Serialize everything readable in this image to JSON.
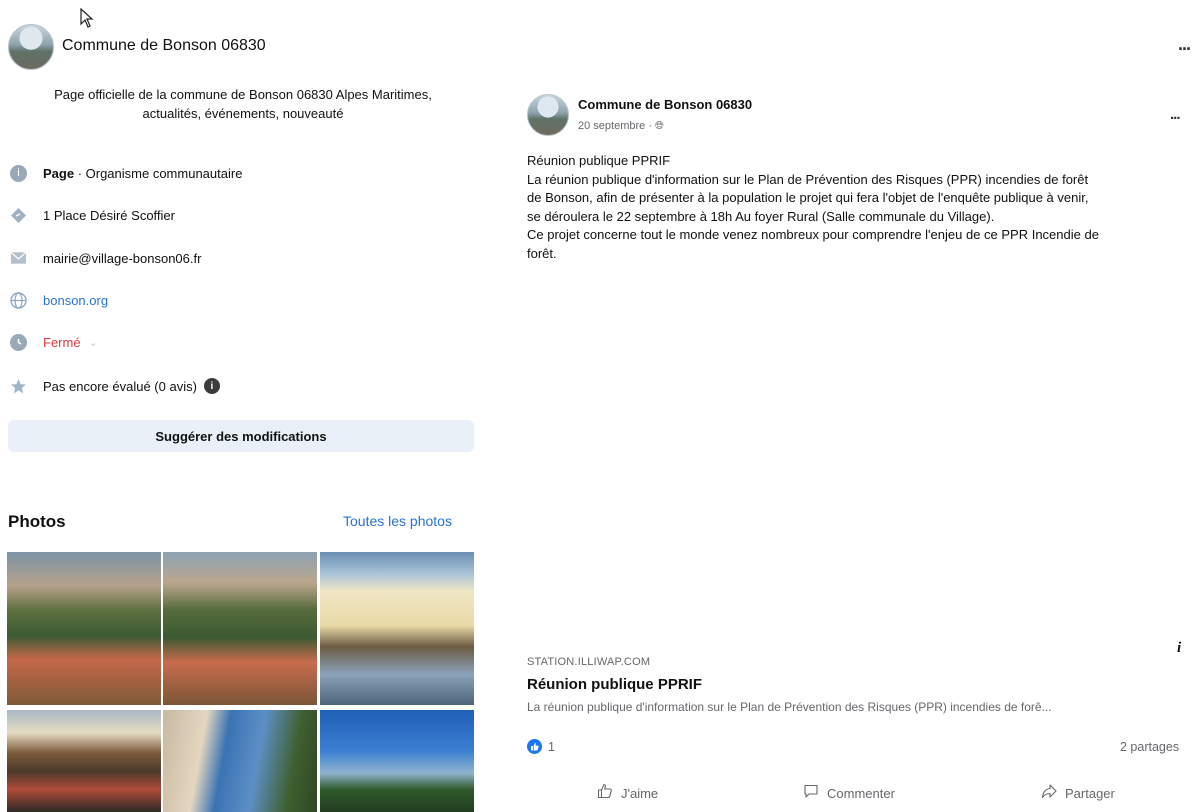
{
  "header": {
    "page_name": "Commune de Bonson 06830",
    "more_label": "..."
  },
  "intro": {
    "description_line1": "Page officielle de la commune de Bonson 06830 Alpes Maritimes,",
    "description_line2": "actualités, événements, nouveauté",
    "items": [
      {
        "icon": "info-icon",
        "label_bold": "Page",
        "label_rest": " · Organisme communautaire"
      },
      {
        "icon": "location-icon",
        "label": "1 Place Désiré Scoffier"
      },
      {
        "icon": "mail-icon",
        "label": "mairie@village-bonson06.fr"
      },
      {
        "icon": "globe-icon",
        "label": "bonson.org"
      },
      {
        "icon": "clock-icon",
        "label": "Fermé",
        "caret": "⌄"
      },
      {
        "icon": "star-icon",
        "label": "Pas encore évalué (0 avis)"
      }
    ],
    "suggest_label": "Suggérer des modifications"
  },
  "photos": {
    "title": "Photos",
    "see_all": "Toutes les photos"
  },
  "post": {
    "author": "Commune de Bonson 06830",
    "date": "20 septembre",
    "date_sep": " · ",
    "more_label": "...",
    "text_lines": [
      "Réunion publique PPRIF",
      "La réunion publique d'information sur le Plan de Prévention des Risques (PPR) incendies de forêt",
      "de Bonson, afin de présenter à la population le projet qui fera l'objet de l'enquête publique à venir,",
      "se déroulera le 22 septembre à 18h Au foyer Rural (Salle communale du Village).",
      "Ce projet concerne tout le monde venez nombreux pour comprendre l'enjeu de ce PPR Incendie de",
      "forêt."
    ],
    "link_preview": {
      "domain": "STATION.ILLIWAP.COM",
      "title": "Réunion publique PPRIF",
      "description": "La réunion publique d'information sur le Plan de Prévention des Risques (PPR) incendies de forê...",
      "info_label": "i"
    },
    "reactions_count": "1",
    "shares": "2 partages",
    "actions": {
      "like": "J'aime",
      "comment": "Commenter",
      "share": "Partager"
    }
  },
  "colors": {
    "link": "#2a73cf",
    "closed_red": "#d93a3a",
    "like_blue": "#1877f2",
    "suggest_bg": "#e9f0f7"
  }
}
